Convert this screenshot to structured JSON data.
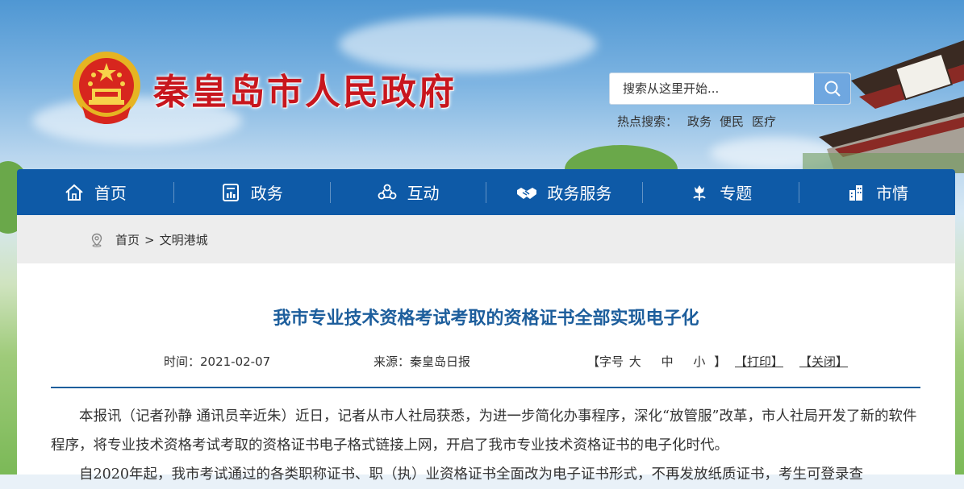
{
  "header": {
    "site_title": "秦皇岛市人民政府",
    "search_placeholder": "搜索从这里开始...",
    "hot_label": "热点搜索：",
    "hot_links": [
      "政务",
      "便民",
      "医疗"
    ]
  },
  "nav": {
    "items": [
      {
        "label": "首页",
        "icon": "home-icon"
      },
      {
        "label": "政务",
        "icon": "chart-icon"
      },
      {
        "label": "互动",
        "icon": "people-icon"
      },
      {
        "label": "政务服务",
        "icon": "handshake-icon"
      },
      {
        "label": "专题",
        "icon": "flower-icon"
      },
      {
        "label": "市情",
        "icon": "building-icon"
      }
    ]
  },
  "breadcrumb": {
    "items": [
      "首页",
      "文明港城"
    ],
    "separator": ">"
  },
  "article": {
    "title": "我市专业技术资格考试考取的资格证书全部实现电子化",
    "time": "时间：2021-02-07",
    "source": "来源：秦皇岛日报",
    "font_size_open": "【字号",
    "font_large": "大",
    "font_medium": "中",
    "font_small": "小",
    "font_size_close": "】",
    "print": "【打印】",
    "close": "【关闭】",
    "paragraphs": [
      "本报讯（记者孙静  通讯员辛近朱）近日，记者从市人社局获悉，为进一步简化办事程序，深化“放管服”改革，市人社局开发了新的软件程序，将专业技术资格考试考取的资格证书电子格式链接上网，开启了我市专业技术资格证书的电子化时代。",
      "自2020年起，我市考试通过的各类职称证书、职（执）业资格证书全面改为电子证书形式，不再发放纸质证书，考生可登录查"
    ]
  },
  "colors": {
    "nav_bg": "#0e5aa7",
    "title_red": "#c8161d",
    "article_title_blue": "#1d5e9c"
  }
}
